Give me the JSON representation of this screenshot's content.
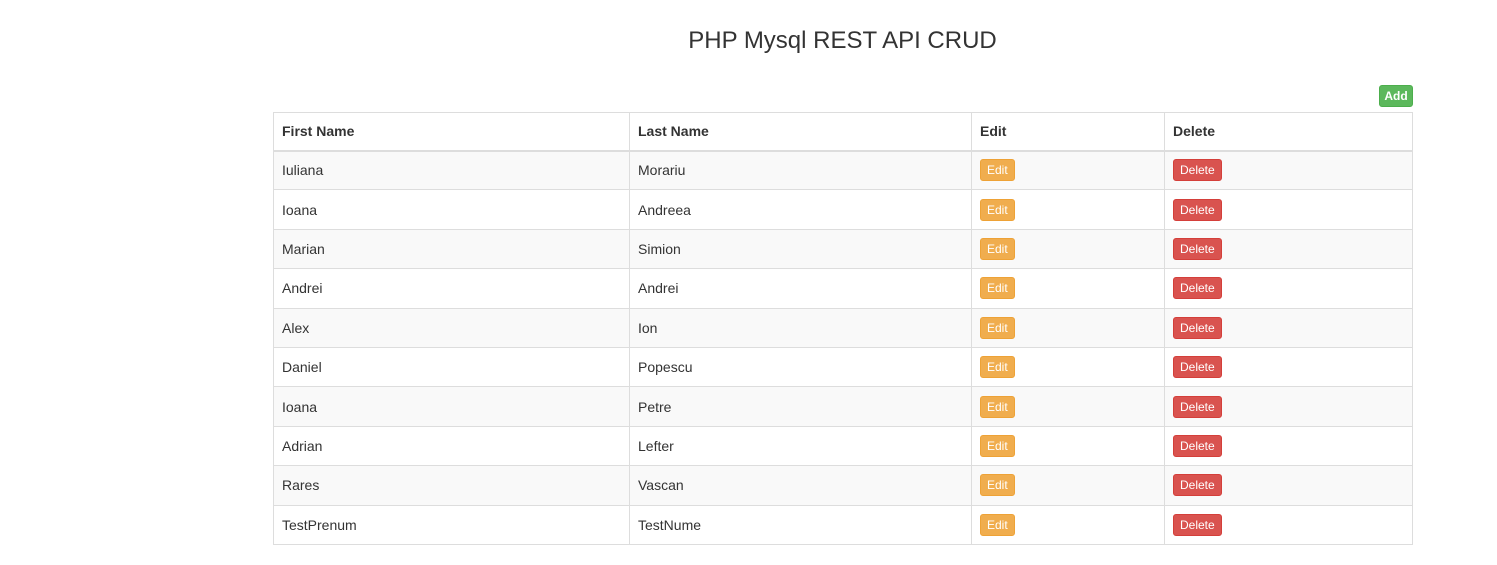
{
  "title": "PHP Mysql REST API CRUD",
  "add_label": "Add",
  "columns": [
    "First Name",
    "Last Name",
    "Edit",
    "Delete"
  ],
  "edit_label": "Edit",
  "delete_label": "Delete",
  "rows": [
    [
      "Iuliana",
      "Morariu"
    ],
    [
      "Ioana",
      "Andreea"
    ],
    [
      "Marian",
      "Simion"
    ],
    [
      "Andrei",
      "Andrei"
    ],
    [
      "Alex",
      "Ion"
    ],
    [
      "Daniel",
      "Popescu"
    ],
    [
      "Ioana",
      "Petre"
    ],
    [
      "Adrian",
      "Lefter"
    ],
    [
      "Rares",
      "Vascan"
    ],
    [
      "TestPrenum",
      "TestNume"
    ]
  ],
  "colors": {
    "add": "#5cb85c",
    "edit": "#f0ad4e",
    "delete": "#d9534f"
  }
}
